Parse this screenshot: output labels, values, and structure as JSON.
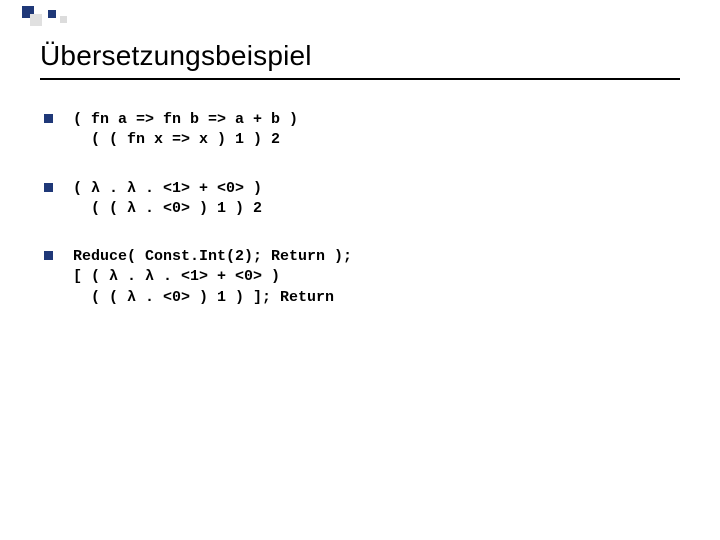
{
  "slide": {
    "title": "Übersetzungsbeispiel",
    "items": [
      {
        "code": "( fn a => fn b => a + b )\n  ( ( fn x => x ) 1 ) 2"
      },
      {
        "code": "( λ . λ . <1> + <0> )\n  ( ( λ . <0> ) 1 ) 2"
      },
      {
        "code": "Reduce( Const.Int(2); Return );\n[ ( λ . λ . <1> + <0> )\n  ( ( λ . <0> ) 1 ) ]; Return"
      }
    ]
  }
}
